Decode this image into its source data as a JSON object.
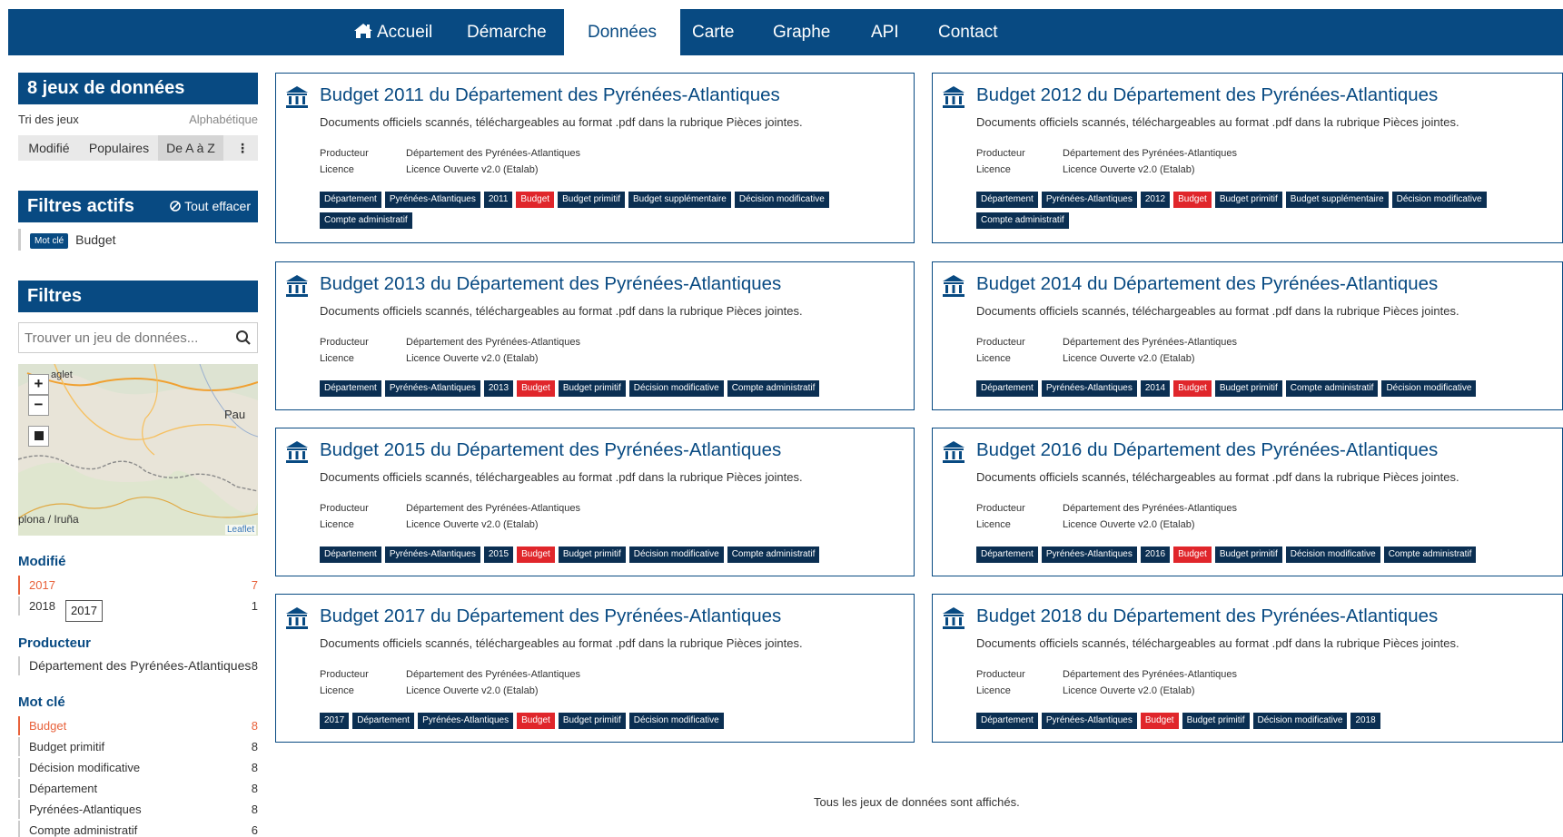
{
  "nav": {
    "items": [
      {
        "label": "Accueil"
      },
      {
        "label": "Démarche"
      },
      {
        "label": "Données"
      },
      {
        "label": "Carte"
      },
      {
        "label": "Graphe"
      },
      {
        "label": "API"
      },
      {
        "label": "Contact"
      }
    ],
    "active": "Données"
  },
  "sidebar": {
    "count_title": "8 jeux de données",
    "sort_label": "Tri des jeux",
    "sort_value": "Alphabétique",
    "sort_buttons": [
      "Modifié",
      "Populaires",
      "De A à Z",
      "⋮"
    ],
    "active_filters_title": "Filtres actifs",
    "clear_label": "Tout effacer",
    "active_filter_badge": "Mot clé",
    "active_filter_value": "Budget",
    "filters_title": "Filtres",
    "search_placeholder": "Trouver un jeu de données...",
    "map": {
      "labels": [
        "Pau",
        "plona / Iruña",
        "aglet"
      ],
      "attribution": "Leaflet",
      "zoom_in": "+",
      "zoom_out": "−"
    },
    "facets": {
      "modified": {
        "title": "Modifié",
        "items": [
          {
            "label": "2017",
            "count": "7"
          },
          {
            "label": "2018",
            "count": "1"
          }
        ],
        "tooltip": "2017"
      },
      "producer": {
        "title": "Producteur",
        "items": [
          {
            "label": "Département des Pyrénées-Atlantiques",
            "count": "8"
          }
        ]
      },
      "keyword": {
        "title": "Mot clé",
        "items": [
          {
            "label": "Budget",
            "count": "8"
          },
          {
            "label": "Budget primitif",
            "count": "8"
          },
          {
            "label": "Décision modificative",
            "count": "8"
          },
          {
            "label": "Département",
            "count": "8"
          },
          {
            "label": "Pyrénées-Atlantiques",
            "count": "8"
          },
          {
            "label": "Compte administratif",
            "count": "6"
          }
        ]
      }
    }
  },
  "datasets": [
    {
      "title": "Budget 2011 du Département des Pyrénées-Atlantiques",
      "description": "Documents officiels scannés, téléchargeables au format .pdf dans la rubrique Pièces jointes.",
      "producer_label": "Producteur",
      "producer": "Département des Pyrénées-Atlantiques",
      "license_label": "Licence",
      "license": "Licence Ouverte v2.0 (Etalab)",
      "tags": [
        "Département",
        "Pyrénées-Atlantiques",
        "2011",
        "Budget",
        "Budget primitif",
        "Budget supplémentaire",
        "Décision modificative",
        "Compte administratif"
      ]
    },
    {
      "title": "Budget 2012 du Département des Pyrénées-Atlantiques",
      "description": "Documents officiels scannés, téléchargeables au format .pdf dans la rubrique Pièces jointes.",
      "producer_label": "Producteur",
      "producer": "Département des Pyrénées-Atlantiques",
      "license_label": "Licence",
      "license": "Licence Ouverte v2.0 (Etalab)",
      "tags": [
        "Département",
        "Pyrénées-Atlantiques",
        "2012",
        "Budget",
        "Budget primitif",
        "Budget supplémentaire",
        "Décision modificative",
        "Compte administratif"
      ]
    },
    {
      "title": "Budget 2013 du Département des Pyrénées-Atlantiques",
      "description": "Documents officiels scannés, téléchargeables au format .pdf dans la rubrique Pièces jointes.",
      "producer_label": "Producteur",
      "producer": "Département des Pyrénées-Atlantiques",
      "license_label": "Licence",
      "license": "Licence Ouverte v2.0 (Etalab)",
      "tags": [
        "Département",
        "Pyrénées-Atlantiques",
        "2013",
        "Budget",
        "Budget primitif",
        "Décision modificative",
        "Compte administratif"
      ]
    },
    {
      "title": "Budget 2014 du Département des Pyrénées-Atlantiques",
      "description": "Documents officiels scannés, téléchargeables au format .pdf dans la rubrique Pièces jointes.",
      "producer_label": "Producteur",
      "producer": "Département des Pyrénées-Atlantiques",
      "license_label": "Licence",
      "license": "Licence Ouverte v2.0 (Etalab)",
      "tags": [
        "Département",
        "Pyrénées-Atlantiques",
        "2014",
        "Budget",
        "Budget primitif",
        "Compte administratif",
        "Décision modificative"
      ]
    },
    {
      "title": "Budget 2015 du Département des Pyrénées-Atlantiques",
      "description": "Documents officiels scannés, téléchargeables au format .pdf dans la rubrique Pièces jointes.",
      "producer_label": "Producteur",
      "producer": "Département des Pyrénées-Atlantiques",
      "license_label": "Licence",
      "license": "Licence Ouverte v2.0 (Etalab)",
      "tags": [
        "Département",
        "Pyrénées-Atlantiques",
        "2015",
        "Budget",
        "Budget primitif",
        "Décision modificative",
        "Compte administratif"
      ]
    },
    {
      "title": "Budget 2016 du Département des Pyrénées-Atlantiques",
      "description": "Documents officiels scannés, téléchargeables au format .pdf dans la rubrique Pièces jointes.",
      "producer_label": "Producteur",
      "producer": "Département des Pyrénées-Atlantiques",
      "license_label": "Licence",
      "license": "Licence Ouverte v2.0 (Etalab)",
      "tags": [
        "Département",
        "Pyrénées-Atlantiques",
        "2016",
        "Budget",
        "Budget primitif",
        "Décision modificative",
        "Compte administratif"
      ]
    },
    {
      "title": "Budget 2017 du Département des Pyrénées-Atlantiques",
      "description": "Documents officiels scannés, téléchargeables au format .pdf dans la rubrique Pièces jointes.",
      "producer_label": "Producteur",
      "producer": "Département des Pyrénées-Atlantiques",
      "license_label": "Licence",
      "license": "Licence Ouverte v2.0 (Etalab)",
      "tags": [
        "2017",
        "Département",
        "Pyrénées-Atlantiques",
        "Budget",
        "Budget primitif",
        "Décision modificative"
      ]
    },
    {
      "title": "Budget 2018 du Département des Pyrénées-Atlantiques",
      "description": "Documents officiels scannés, téléchargeables au format .pdf dans la rubrique Pièces jointes.",
      "producer_label": "Producteur",
      "producer": "Département des Pyrénées-Atlantiques",
      "license_label": "Licence",
      "license": "Licence Ouverte v2.0 (Etalab)",
      "tags": [
        "Département",
        "Pyrénées-Atlantiques",
        "Budget",
        "Budget primitif",
        "Décision modificative",
        "2018"
      ]
    }
  ],
  "highlight_tag": "Budget",
  "footer_note": "Tous les jeux de données sont affichés.",
  "colors": {
    "primary": "#084a82",
    "tag": "#0b2f52",
    "tag_highlight": "#e0262b",
    "selected": "#e8613a"
  }
}
